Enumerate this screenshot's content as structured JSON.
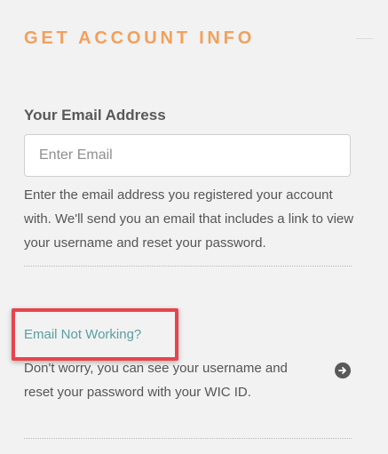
{
  "section": {
    "title": "GET ACCOUNT INFO"
  },
  "email": {
    "label": "Your Email Address",
    "placeholder": "Enter Email",
    "value": "",
    "help": "Enter the email address you registered your account with. We'll send you an email that includes a link to view your username and reset your password."
  },
  "alternate": {
    "link_label": "Email Not Working?",
    "description": "Don't worry, you can see your username and reset your password with your WIC ID.",
    "arrow_icon": "arrow-right-circle-icon"
  },
  "colors": {
    "title": "#f2a05c",
    "link": "#5a9fa3",
    "highlight": "#e8444d",
    "background": "#f2f2f2"
  }
}
